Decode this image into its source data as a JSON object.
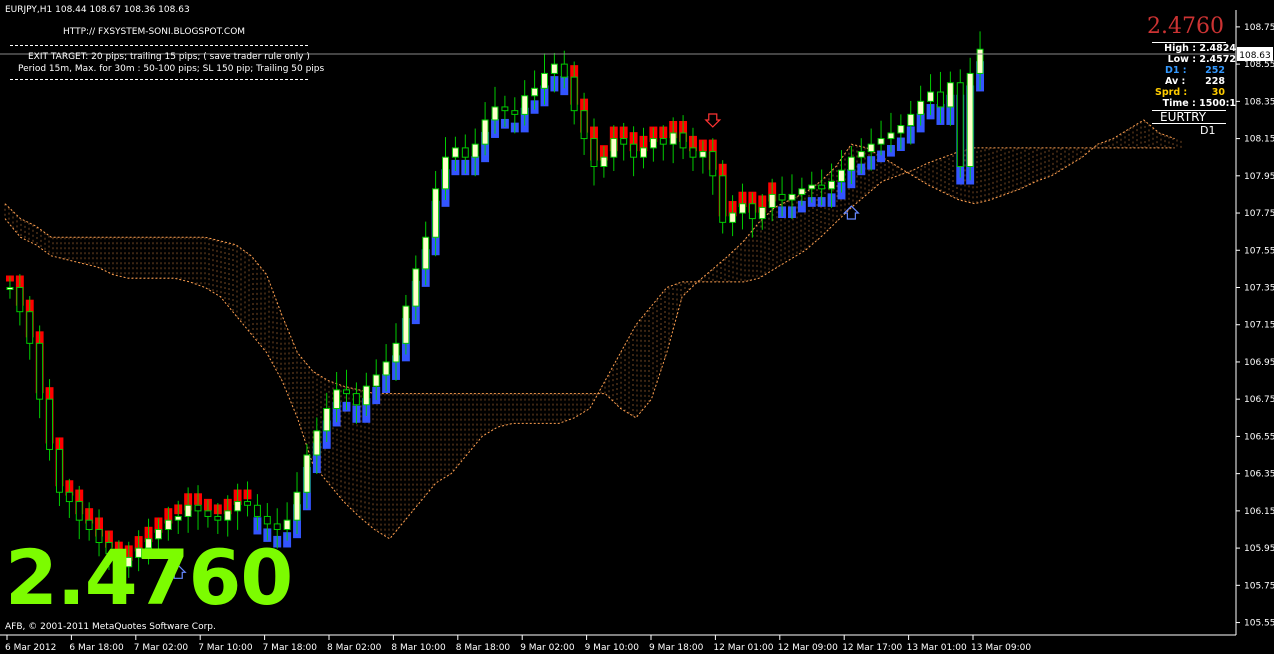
{
  "window": {
    "title": "EURJPY,H1  108.44 108.67 108.36 108.63",
    "blog": "HTTP:// FXSYSTEM-SONI.BLOGSPOT.COM",
    "exit_target": "EXIT TARGET: 20 pips; trailing 15 pips; ( save trader rule only )",
    "period_line": "Period 15m, Max. for 30m  : 50-100 pips; SL 150 pip; Trailing 50 pips",
    "copyright": "AFB, © 2001-2011 MetaQuotes Software Corp.",
    "big_price": "2.4760",
    "current_price_tag": "108.63"
  },
  "panel": {
    "price": "2.4760",
    "high": "High : 2.4824",
    "low": "Low : 2.4572",
    "d1_label": "D1 :",
    "d1_value": "252",
    "av_label": "Av :",
    "av_value": "228",
    "sprd_label": "Sprd :",
    "sprd_value": "30",
    "time": "Time : 1500:1",
    "symbol": "EURTRY",
    "timeframe": "D1"
  },
  "colors": {
    "background": "#000000",
    "bull_candle": "#00cc00",
    "bull_body": "#ffffcc",
    "trend_red": "#ff0000",
    "trend_blue": "#3355ff",
    "cloud": "#ffa050",
    "big_price": "#7cfc00",
    "panel_price": "#cc3333"
  },
  "chart_data": {
    "type": "candlestick",
    "symbol": "EURJPY",
    "timeframe": "H1",
    "y_ticks": [
      "108.75",
      "108.55",
      "108.35",
      "108.15",
      "107.95",
      "107.75",
      "107.55",
      "107.35",
      "107.15",
      "106.95",
      "106.75",
      "106.55",
      "106.35",
      "106.15",
      "105.95",
      "105.75",
      "105.55"
    ],
    "ylim": [
      105.51,
      108.83
    ],
    "x_ticks": [
      "6 Mar 2012",
      "6 Mar 18:00",
      "7 Mar 02:00",
      "7 Mar 10:00",
      "7 Mar 18:00",
      "8 Mar 02:00",
      "8 Mar 10:00",
      "8 Mar 18:00",
      "9 Mar 02:00",
      "9 Mar 10:00",
      "9 Mar 18:00",
      "12 Mar 01:00",
      "12 Mar 09:00",
      "12 Mar 17:00",
      "13 Mar 01:00",
      "13 Mar 09:00"
    ],
    "close": [
      107.35,
      107.22,
      107.05,
      106.75,
      106.48,
      106.25,
      106.2,
      106.1,
      106.05,
      105.98,
      105.92,
      105.85,
      105.9,
      105.95,
      106.0,
      106.05,
      106.1,
      106.12,
      106.18,
      106.15,
      106.12,
      106.1,
      106.15,
      106.2,
      106.18,
      106.12,
      106.08,
      106.05,
      106.1,
      106.25,
      106.45,
      106.58,
      106.7,
      106.8,
      106.78,
      106.72,
      106.82,
      106.88,
      106.95,
      107.05,
      107.25,
      107.45,
      107.62,
      107.88,
      108.05,
      108.1,
      108.05,
      108.12,
      108.25,
      108.32,
      108.3,
      108.28,
      108.38,
      108.42,
      108.5,
      108.55,
      108.48,
      108.3,
      108.15,
      108.0,
      108.05,
      108.15,
      108.12,
      108.05,
      108.1,
      108.15,
      108.12,
      108.18,
      108.1,
      108.05,
      108.08,
      107.95,
      107.7,
      107.75,
      107.8,
      107.72,
      107.78,
      107.85,
      107.82,
      107.85,
      107.88,
      107.9,
      107.88,
      107.92,
      107.98,
      108.05,
      108.08,
      108.12,
      108.15,
      108.18,
      108.22,
      108.28,
      108.35,
      108.4,
      108.32,
      108.45,
      108.0,
      108.5,
      108.63
    ],
    "trend_colors": [
      "red",
      "red",
      "red",
      "red",
      "red",
      "red",
      "red",
      "red",
      "red",
      "red",
      "red",
      "red",
      "red",
      "red",
      "red",
      "red",
      "red",
      "red",
      "red",
      "red",
      "red",
      "red",
      "red",
      "red",
      "red",
      "blue",
      "blue",
      "blue",
      "blue",
      "blue",
      "blue",
      "blue",
      "blue",
      "blue",
      "blue",
      "blue",
      "blue",
      "blue",
      "blue",
      "blue",
      "blue",
      "blue",
      "blue",
      "blue",
      "blue",
      "blue",
      "blue",
      "blue",
      "blue",
      "blue",
      "blue",
      "blue",
      "blue",
      "blue",
      "blue",
      "blue",
      "blue",
      "red",
      "red",
      "red",
      "red",
      "red",
      "red",
      "red",
      "red",
      "red",
      "red",
      "red",
      "red",
      "red",
      "red",
      "red",
      "red",
      "red",
      "red",
      "red",
      "red",
      "red",
      "blue",
      "blue",
      "blue",
      "blue",
      "blue",
      "blue",
      "blue",
      "blue",
      "blue",
      "blue",
      "blue",
      "blue",
      "blue",
      "blue",
      "blue",
      "blue",
      "blue",
      "blue",
      "blue",
      "blue",
      "blue"
    ],
    "cloud_upper": [
      107.8,
      107.72,
      107.68,
      107.62,
      107.62,
      107.62,
      107.62,
      107.62,
      107.62,
      107.62,
      107.62,
      107.62,
      107.62,
      107.62,
      107.6,
      107.58,
      107.52,
      107.42,
      107.2,
      107.0,
      106.9,
      106.85,
      106.82,
      106.8,
      106.78,
      106.78,
      106.78,
      106.78,
      106.78,
      106.78,
      106.78,
      106.78,
      106.78,
      106.78,
      106.78,
      106.78,
      106.78,
      106.78,
      106.78,
      106.78,
      106.7,
      106.65,
      106.75,
      107.0,
      107.3,
      107.38,
      107.45,
      107.52,
      107.6,
      107.7,
      107.78,
      107.82,
      107.86,
      107.92,
      108.0,
      108.12,
      108.1,
      108.05,
      108.0,
      107.95,
      107.9,
      107.86,
      107.82,
      107.8,
      107.82,
      107.85,
      107.88,
      107.92,
      107.95,
      108.0,
      108.05,
      108.12,
      108.15,
      108.2,
      108.25,
      108.18,
      108.15
    ],
    "cloud_lower": [
      107.72,
      107.62,
      107.58,
      107.52,
      107.5,
      107.48,
      107.46,
      107.42,
      107.4,
      107.4,
      107.4,
      107.4,
      107.38,
      107.35,
      107.3,
      107.2,
      107.1,
      107.0,
      106.85,
      106.65,
      106.4,
      106.3,
      106.2,
      106.12,
      106.05,
      106.0,
      106.1,
      106.2,
      106.3,
      106.35,
      106.45,
      106.55,
      106.6,
      106.62,
      106.62,
      106.62,
      106.62,
      106.65,
      106.7,
      106.85,
      107.0,
      107.15,
      107.25,
      107.35,
      107.38,
      107.38,
      107.38,
      107.38,
      107.38,
      107.4,
      107.45,
      107.5,
      107.55,
      107.62,
      107.7,
      107.78,
      107.85,
      107.92,
      107.95,
      107.98,
      108.02,
      108.05,
      108.08,
      108.1,
      108.1,
      108.1,
      108.1,
      108.1,
      108.1,
      108.1,
      108.1,
      108.1,
      108.1,
      108.1,
      108.1,
      108.1,
      108.1
    ],
    "signals": [
      {
        "type": "sell",
        "index": 71
      },
      {
        "type": "buy",
        "index": 17
      },
      {
        "type": "buy",
        "index": 85
      }
    ]
  }
}
